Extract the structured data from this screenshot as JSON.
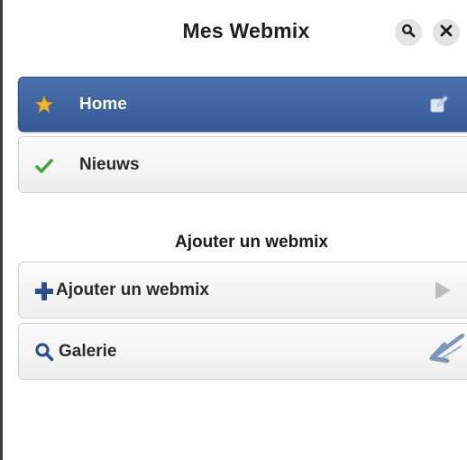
{
  "header": {
    "title": "Mes Webmix"
  },
  "menu": {
    "items": [
      {
        "label": "Home",
        "icon": "star-icon",
        "active": true
      },
      {
        "label": "Nieuws",
        "icon": "check-icon",
        "active": false
      }
    ]
  },
  "section": {
    "heading": "Ajouter un webmix",
    "items": [
      {
        "label": "Ajouter un webmix",
        "icon": "plus-icon"
      },
      {
        "label": "Galerie",
        "icon": "search-icon"
      }
    ]
  },
  "colors": {
    "active_item": "#3d63a0",
    "star": "#f2b233",
    "check": "#3fa83d",
    "plus": "#2d4f8f"
  }
}
